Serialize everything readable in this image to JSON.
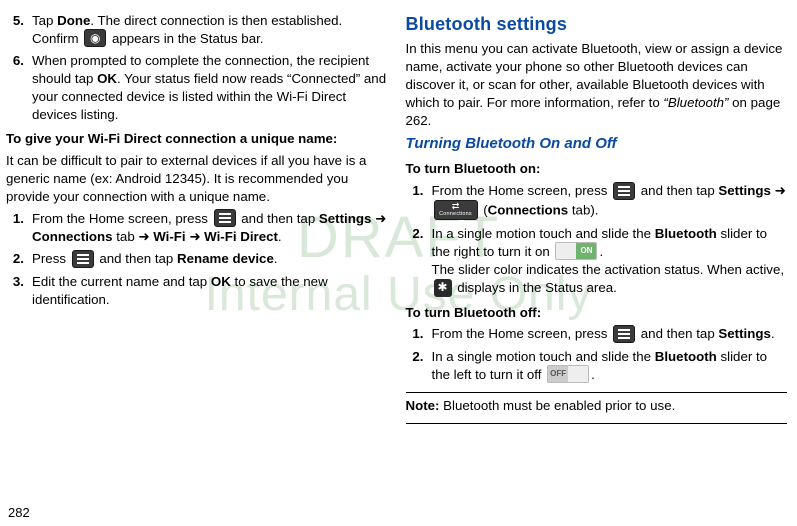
{
  "watermark": {
    "line1": "DRAFT",
    "line2": "Internal Use Only"
  },
  "page_number": "282",
  "left": {
    "step5": {
      "num": "5.",
      "l1a": "Tap ",
      "l1b": "Done",
      "l1c": ". The direct connection is then established. ",
      "l2a": "Confirm ",
      "l2b": " appears in the Status bar."
    },
    "step6": {
      "num": "6.",
      "l1": "When prompted to complete the connection, the ",
      "l2a": "recipient should tap ",
      "l2b": "OK",
      "l2c": ". Your status field now reads ",
      "l3": "“Connected” and your connected device is listed within the Wi-Fi Direct devices listing."
    },
    "h_sub": "To give your Wi-Fi Direct connection a unique name:",
    "para1": "It can be difficult to pair to external devices if all you have is a generic name (ex: Android 12345). It is recommended you provide your connection with a unique name.",
    "s1": {
      "num": "1.",
      "a": "From the Home screen, press ",
      "b": " and then tap ",
      "c1": "Settings",
      "c2": " ➜ ",
      "c3": "Connections",
      "c4": " tab ➜ ",
      "c5": "Wi-Fi",
      "c6": " ➜ ",
      "c7": "Wi-Fi Direct",
      "c8": "."
    },
    "s2": {
      "num": "2.",
      "a": "Press ",
      "b": " and then tap ",
      "c": "Rename device",
      "d": "."
    },
    "s3": {
      "num": "3.",
      "a": "Edit the current name and tap ",
      "b": "OK",
      "c": " to save the new identification."
    }
  },
  "right": {
    "h2": "Bluetooth settings",
    "intro_a": "In this menu you can activate Bluetooth, view or assign a device name, activate your phone so other Bluetooth devices can discover it, or scan for other, available Bluetooth devices with which to pair. For more information, refer to ",
    "intro_b": "“Bluetooth”",
    "intro_c": " on page 262.",
    "h3": "Turning Bluetooth On and Off",
    "on_heading": "To turn Bluetooth on:",
    "on_s1": {
      "num": "1.",
      "a": "From the Home screen, press ",
      "b": " and then tap ",
      "c": "Settings",
      "d": " ➜ ",
      "e": " (",
      "f": "Connections",
      "g": " tab)."
    },
    "on_s2": {
      "num": "2.",
      "a": "In a single motion touch and slide the ",
      "b": "Bluetooth",
      "c": " slider to the right to turn it on ",
      "d": ".",
      "e": "The slider color indicates the activation status. When active, ",
      "f": " displays in the Status area."
    },
    "off_heading": "To turn Bluetooth off:",
    "off_s1": {
      "num": "1.",
      "a": "From the Home screen, press ",
      "b": " and then tap ",
      "c": "Settings",
      "d": "."
    },
    "off_s2": {
      "num": "2.",
      "a": "In a single motion touch and slide the ",
      "b": "Bluetooth",
      "c": " slider to the left to turn it off ",
      "d": "."
    },
    "note_a": "Note:",
    "note_b": " Bluetooth must be enabled prior to use."
  },
  "icons": {
    "on_text": "ON",
    "off_text": "OFF",
    "conn_label": "Connections"
  }
}
